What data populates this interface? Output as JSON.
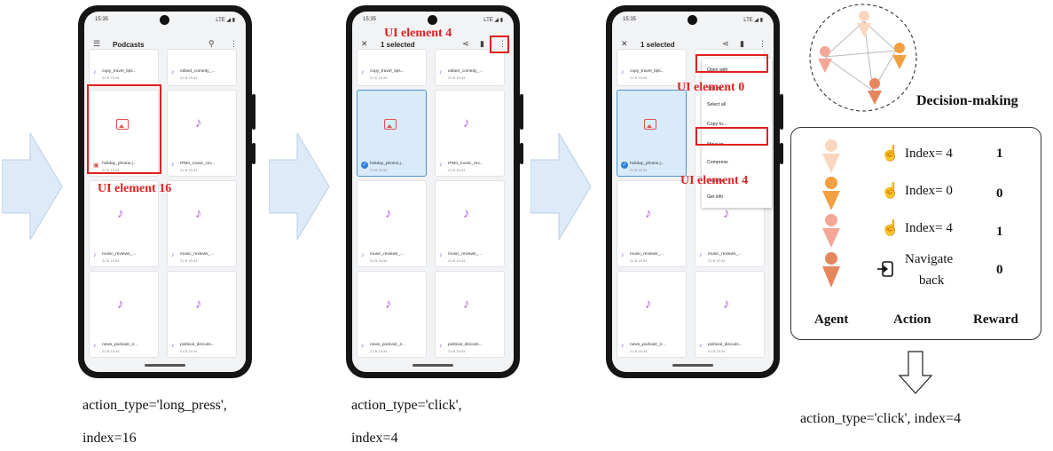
{
  "screens": [
    {
      "status_time": "15:35",
      "status_network": "LTE ◢ ▮",
      "toolbar_title": "Podcasts",
      "files": [
        {
          "name": "copy_travel_tips...",
          "date": "21 B 15:34",
          "kind": "audio"
        },
        {
          "name": "edited_comedy_...",
          "date": "21 B 15:34",
          "kind": "audio"
        },
        {
          "name": "holiday_photos.j...",
          "date": "21 B 15:34",
          "kind": "image"
        },
        {
          "name": "IPMn_music_rev...",
          "date": "21 B 15:34",
          "kind": "audio"
        },
        {
          "name": "music_reviews_...",
          "date": "21 B 15:34",
          "kind": "audio"
        },
        {
          "name": "music_reviews_...",
          "date": "21 B 15:34",
          "kind": "audio"
        },
        {
          "name": "news_podcast_2...",
          "date": "21 B 15:34",
          "kind": "audio"
        },
        {
          "name": "political_discuss...",
          "date": "21 B 15:34",
          "kind": "audio"
        }
      ],
      "annotation": "UI element 16",
      "caption_line1": "action_type='long_press',",
      "caption_line2": "index=16"
    },
    {
      "status_time": "15:35",
      "status_network": "LTE ◢ ▮",
      "toolbar_title": "1 selected",
      "annotation": "UI element 4",
      "caption_line1": "action_type='click',",
      "caption_line2": "index=4"
    },
    {
      "status_time": "15:35",
      "status_network": "LTE ◢ ▮",
      "toolbar_title": "1 selected",
      "menu_items": [
        "Open with",
        "Sort by...",
        "Select all",
        "Copy to...",
        "Move to...",
        "Compress",
        "Rename",
        "Get info"
      ],
      "annotation_a": "UI element 0",
      "annotation_b": "UI element 4"
    }
  ],
  "decision": {
    "title": "Decision-making",
    "rows": [
      {
        "agent_color": "#f9d7bf",
        "action": "Index= 4",
        "reward": "1"
      },
      {
        "agent_color": "#f2a040",
        "action": "Index= 0",
        "reward": "0"
      },
      {
        "agent_color": "#f4a697",
        "action": "Index= 4",
        "reward": "1"
      },
      {
        "agent_color": "#e6865e",
        "action": "Navigate back",
        "action_line1": "Navigate",
        "action_line2": "back",
        "reward": "0"
      }
    ],
    "header_agent": "Agent",
    "header_action": "Action",
    "header_reward": "Reward",
    "output": "action_type='click', index=4"
  },
  "colors": {
    "highlight": "#e02020",
    "arrow_fill": "#deeaf7",
    "arrow_stroke": "#b9cfe6",
    "audio_icon": "#b35ae0",
    "selection": "#d9ebfa"
  }
}
